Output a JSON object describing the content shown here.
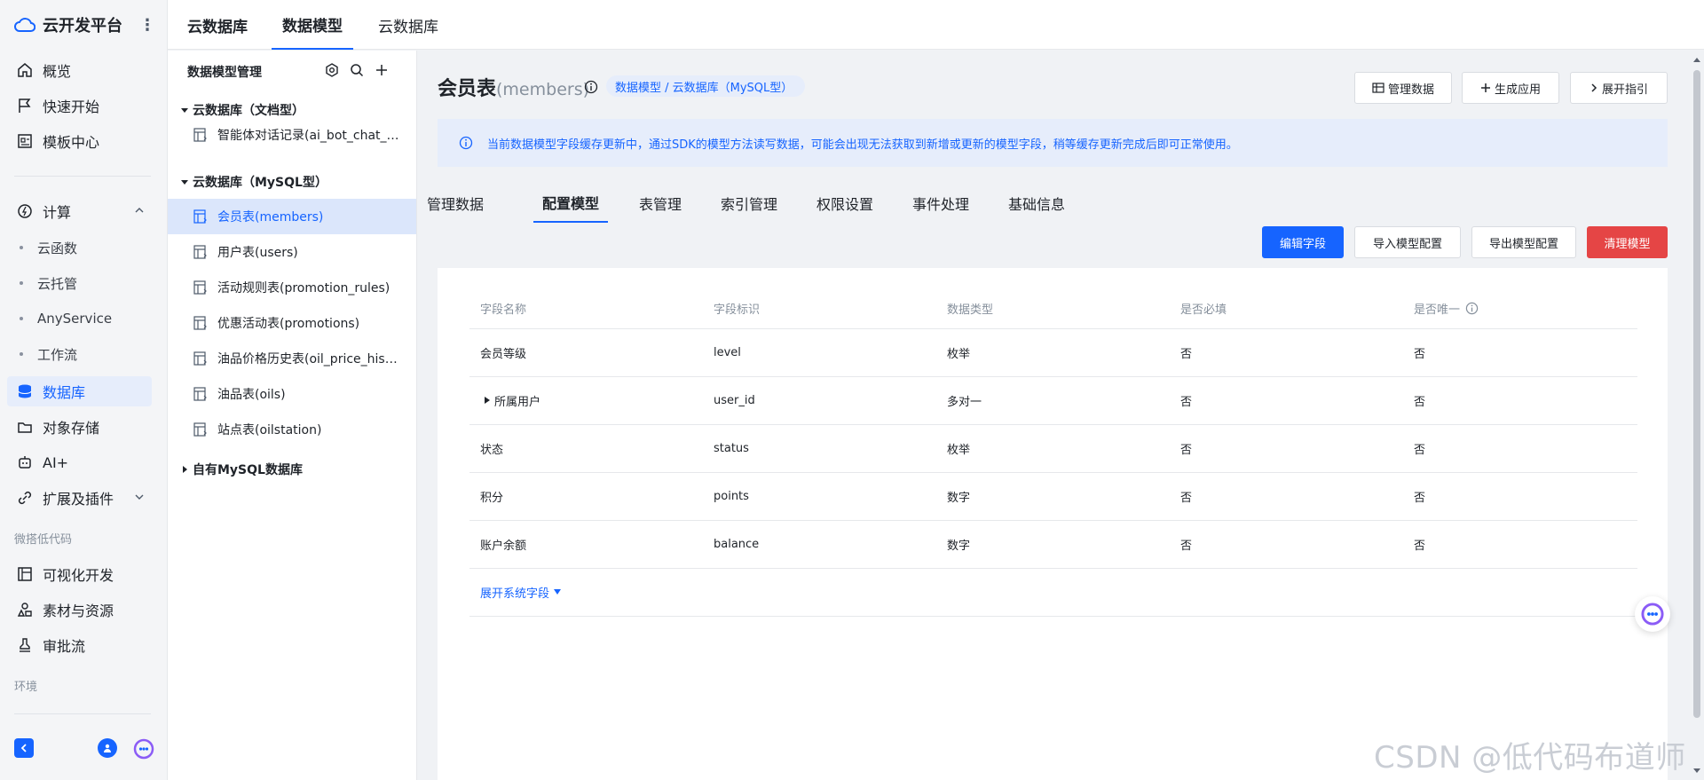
{
  "brand": {
    "title": "云开发平台"
  },
  "nav": {
    "items": [
      {
        "label": "概览",
        "icon": "home-icon"
      },
      {
        "label": "快速开始",
        "icon": "flag-icon"
      },
      {
        "label": "模板中心",
        "icon": "template-icon"
      }
    ],
    "compute": {
      "label": "计算",
      "icon": "compute-icon",
      "subs": [
        "云函数",
        "云托管",
        "AnyService",
        "工作流"
      ]
    },
    "items2": [
      {
        "label": "数据库",
        "icon": "database-icon",
        "active": true
      },
      {
        "label": "对象存储",
        "icon": "storage-icon"
      },
      {
        "label": "AI+",
        "icon": "robot-icon"
      },
      {
        "label": "扩展及插件",
        "icon": "plugin-icon"
      }
    ],
    "group_lowcode": "微搭低代码",
    "items3": [
      {
        "label": "可视化开发",
        "icon": "layout-icon"
      },
      {
        "label": "素材与资源",
        "icon": "assets-icon"
      },
      {
        "label": "审批流",
        "icon": "stamp-icon"
      }
    ],
    "group_env": "环境"
  },
  "top_tabs": [
    "云数据库",
    "数据模型",
    "云数据库"
  ],
  "tree": {
    "title": "数据模型管理",
    "group_doc": "云数据库（文档型）",
    "doc_items": [
      "智能体对话记录(ai_bot_chat_history)"
    ],
    "group_mysql": "云数据库（MySQL型）",
    "mysql_items": [
      "会员表(members)",
      "用户表(users)",
      "活动规则表(promotion_rules)",
      "优惠活动表(promotions)",
      "油品价格历史表(oil_price_history)",
      "油品表(oils)",
      "站点表(oilstation)"
    ],
    "group_own": "自有MySQL数据库"
  },
  "page": {
    "title": "会员表",
    "title_sub": "(members)",
    "tag": "数据模型 / 云数据库（MySQL型）",
    "buttons": {
      "manage": "管理数据",
      "generate": "生成应用",
      "guide": "展开指引"
    },
    "notice": "当前数据模型字段缓存更新中，通过SDK的模型方法读写数据，可能会出现无法获取到新增或更新的模型字段，稍等缓存更新完成后即可正常使用。",
    "subtabs": [
      "管理数据",
      "配置模型",
      "表管理",
      "索引管理",
      "权限设置",
      "事件处理",
      "基础信息"
    ],
    "actions": {
      "edit": "编辑字段",
      "import": "导入模型配置",
      "export": "导出模型配置",
      "clear": "清理模型"
    }
  },
  "table": {
    "headers": [
      "字段名称",
      "字段标识",
      "数据类型",
      "是否必填",
      "是否唯一"
    ],
    "rows": [
      [
        "会员等级",
        "level",
        "枚举",
        "否",
        "否"
      ],
      [
        "所属用户",
        "user_id",
        "多对一",
        "否",
        "否"
      ],
      [
        "状态",
        "status",
        "枚举",
        "否",
        "否"
      ],
      [
        "积分",
        "points",
        "数字",
        "否",
        "否"
      ],
      [
        "账户余额",
        "balance",
        "数字",
        "否",
        "否"
      ]
    ],
    "expand_label": "展开系统字段"
  },
  "watermark": "CSDN @低代码布道师",
  "colors": {
    "primary": "#1664ff",
    "danger": "#e54545",
    "active_bg": "#dbe6fb"
  }
}
